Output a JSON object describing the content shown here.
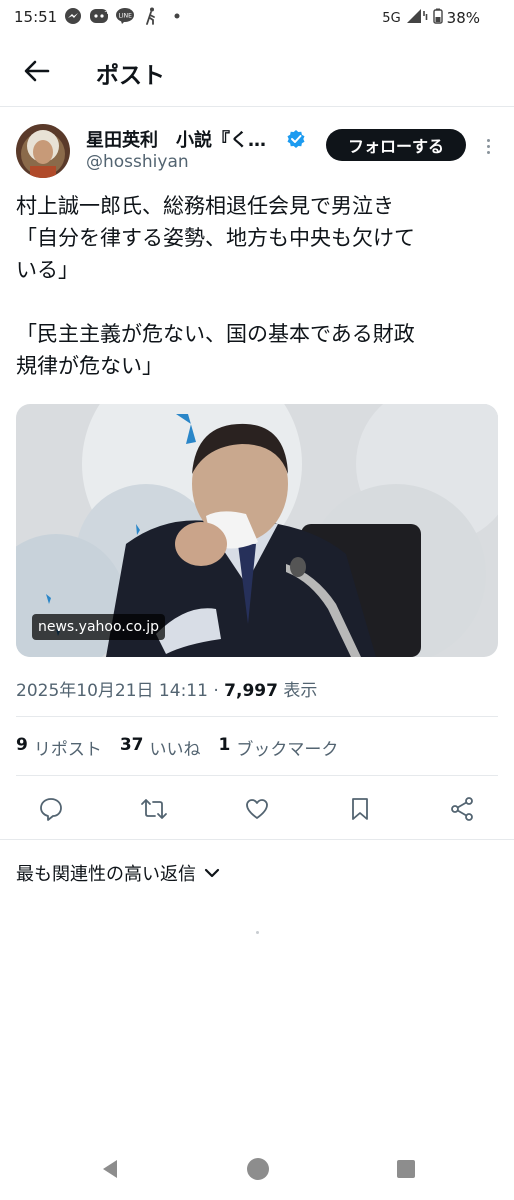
{
  "status_bar": {
    "time": "15:51",
    "network": "5G",
    "battery": "38%",
    "icons": [
      "messenger-icon",
      "discord-icon",
      "line-icon",
      "walking-icon",
      "dot-icon",
      "signal-icon",
      "battery-icon"
    ]
  },
  "header": {
    "title": "ポスト",
    "back_icon": "arrow-left-icon"
  },
  "author": {
    "name": "星田英利　小説『く…",
    "handle": "@hosshiyan",
    "verified": true,
    "follow_label": "フォローする",
    "more_icon": "more-vertical-icon"
  },
  "tweet": {
    "lines": [
      "村上誠一郎氏、総務相退任会見で男泣き",
      "「自分を律する姿勢、地方も中央も欠けて",
      "いる」",
      "",
      "「民主主義が危ない、国の基本である財政",
      "規律が危ない」"
    ],
    "image_source": "news.yahoo.co.jp",
    "timestamp": "2025年10月21日 14:11",
    "separator": " · ",
    "views": "7,997",
    "views_label": "表示"
  },
  "stats": {
    "reposts_count": "9",
    "reposts_label": "リポスト",
    "likes_count": "37",
    "likes_label": "いいね",
    "bookmarks_count": "1",
    "bookmarks_label": "ブックマーク"
  },
  "actions": [
    "reply-icon",
    "repost-icon",
    "like-icon",
    "bookmark-icon",
    "share-icon"
  ],
  "replies": {
    "sort_label": "最も関連性の高い返信"
  },
  "colors": {
    "text": "#0f1419",
    "secondary": "#536471",
    "verified": "#1d9bf0",
    "divider": "#e6e9ec",
    "follow_bg": "#0f1419"
  },
  "nav_bar": [
    "back-triangle-icon",
    "home-circle-icon",
    "recents-square-icon"
  ]
}
